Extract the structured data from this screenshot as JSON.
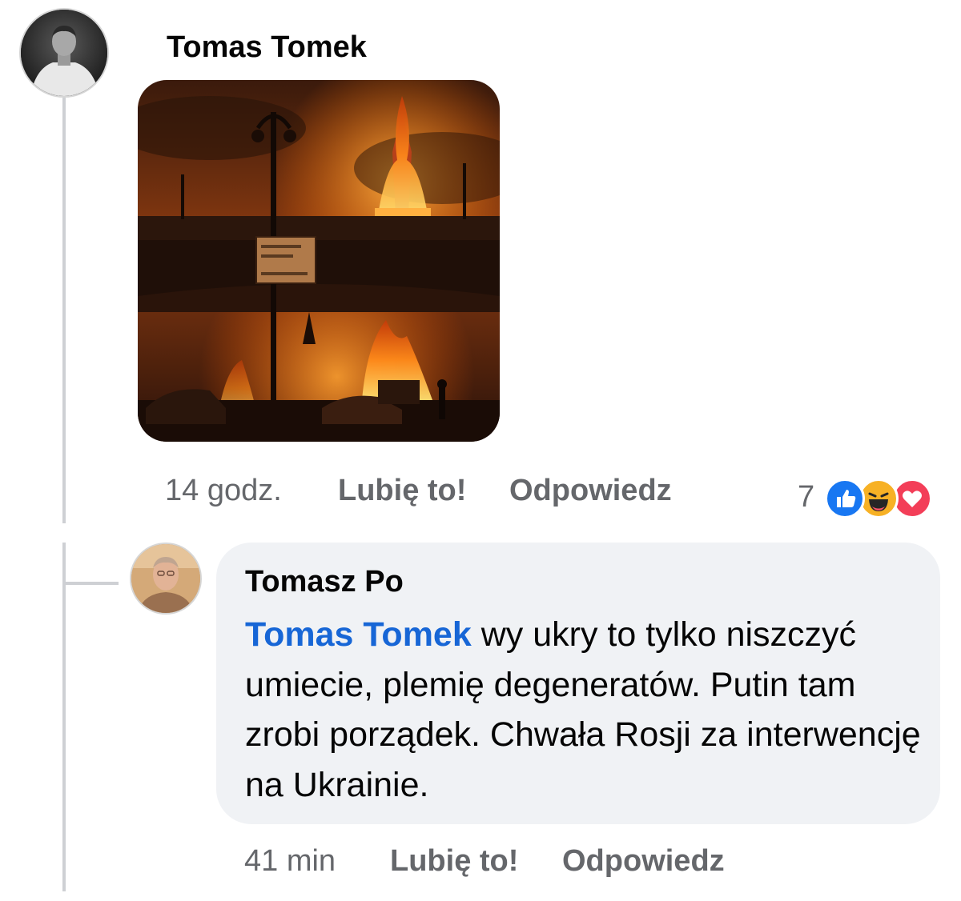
{
  "post": {
    "author": "Tomas Tomek",
    "avatar_icon": "avatar-man-white-shirt",
    "image_icon": "burning-city-illustration",
    "time": "14 godz.",
    "like_label": "Lubię to!",
    "reply_label": "Odpowiedz",
    "reaction_count": "7",
    "reactions": [
      "like-icon",
      "haha-icon",
      "love-icon"
    ]
  },
  "reply": {
    "author": "Tomasz Po",
    "avatar_icon": "avatar-older-man",
    "mention": "Tomas Tomek",
    "text": " wy ukry to tylko niszczyć umiecie, plemię degeneratów. Putin tam zrobi porządek. Chwała Rosji za interwencję na Ukrainie.",
    "time": "41 min",
    "like_label": "Lubię to!",
    "reply_label": "Odpowiedz"
  },
  "colors": {
    "mention": "#1766d6",
    "meta_text": "#65676b",
    "bubble_bg": "#f0f2f5",
    "like_blue": "#1877f2",
    "love_red": "#f33e58",
    "haha_yellow": "#f7b125"
  }
}
